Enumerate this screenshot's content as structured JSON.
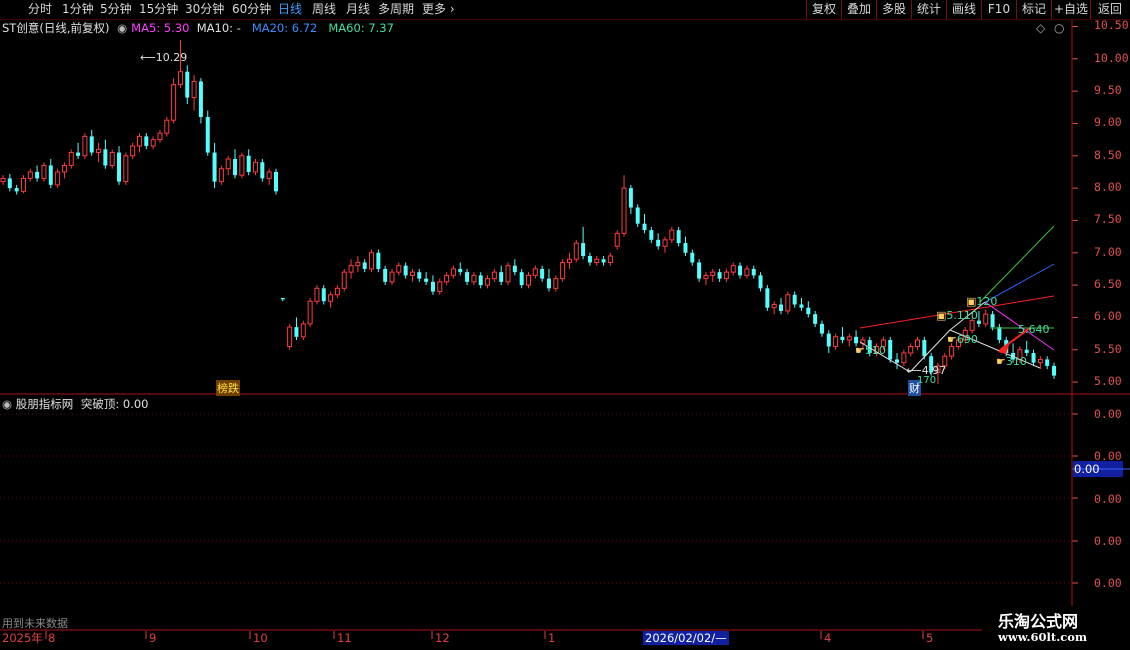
{
  "periods": [
    "分时",
    "1分钟",
    "5分钟",
    "15分钟",
    "30分钟",
    "60分钟",
    "日线",
    "周线",
    "月线",
    "多周期",
    "更多"
  ],
  "active_period": "日线",
  "right_tools": [
    "复权",
    "叠加",
    "多股",
    "统计",
    "画线",
    "F10",
    "标记",
    "+自选",
    "返回"
  ],
  "stock": {
    "name": "ST创意",
    "mode": "(日线,前复权)"
  },
  "ma": {
    "ma5": {
      "label": "MA5:",
      "value": "5.30",
      "color": "#ff40ff"
    },
    "ma10": {
      "label": "MA10:",
      "value": "-",
      "color": "#e0e0e0"
    },
    "ma20": {
      "label": "MA20:",
      "value": "6.72",
      "color": "#3a8cff"
    },
    "ma60": {
      "label": "MA60:",
      "value": "7.37",
      "color": "#40e0a0"
    }
  },
  "price_axis": [
    "10.50",
    "10.00",
    "9.50",
    "9.00",
    "8.50",
    "8.00",
    "7.50",
    "7.00",
    "6.50",
    "6.00",
    "5.50",
    "5.00"
  ],
  "indicator": {
    "name": "股朋指标网",
    "label": "突破顶:",
    "value": "0.00"
  },
  "indicator_axis": [
    "0.00",
    "0.00",
    "0.00",
    "0.00",
    "0.00"
  ],
  "indicator_current": "0.00",
  "future_note": "用到未来数据",
  "date_axis": {
    "year": "2025年",
    "months": [
      "8",
      "9",
      "10",
      "11",
      "12",
      "1",
      "4",
      "5"
    ],
    "cursor_date": "2026/02/02/—"
  },
  "annotations": {
    "high": "10.29",
    "low": "4.97",
    "badge_bangdie": "榜跌",
    "badge_cai": "财",
    "n1": "510",
    "n2": "690",
    "n3": "310",
    "n4": "5.640",
    "n5": "5.110",
    "n6": "120",
    "n7": "170"
  },
  "watermark": {
    "title": "乐淘公式网",
    "url": "www.60lt.com"
  },
  "colors": {
    "up": "#ff3b3b",
    "down": "#54ffff",
    "grid": "#7a0000",
    "axis": "#e05050"
  },
  "chart_data": {
    "type": "candlestick",
    "ylim": [
      4.8,
      10.6
    ],
    "candles": [
      [
        8.1,
        8.2,
        8.05,
        8.15
      ],
      [
        8.15,
        8.22,
        7.95,
        8.0
      ],
      [
        8.0,
        8.05,
        7.9,
        7.95
      ],
      [
        7.95,
        8.2,
        7.92,
        8.15
      ],
      [
        8.15,
        8.3,
        8.1,
        8.25
      ],
      [
        8.25,
        8.35,
        8.1,
        8.15
      ],
      [
        8.15,
        8.4,
        8.1,
        8.35
      ],
      [
        8.35,
        8.45,
        8.0,
        8.05
      ],
      [
        8.05,
        8.3,
        8.0,
        8.25
      ],
      [
        8.25,
        8.4,
        8.15,
        8.35
      ],
      [
        8.35,
        8.6,
        8.3,
        8.55
      ],
      [
        8.55,
        8.7,
        8.45,
        8.5
      ],
      [
        8.5,
        8.85,
        8.45,
        8.8
      ],
      [
        8.8,
        8.9,
        8.5,
        8.55
      ],
      [
        8.55,
        8.7,
        8.4,
        8.6
      ],
      [
        8.6,
        8.75,
        8.3,
        8.35
      ],
      [
        8.35,
        8.6,
        8.3,
        8.55
      ],
      [
        8.55,
        8.65,
        8.05,
        8.1
      ],
      [
        8.1,
        8.55,
        8.05,
        8.5
      ],
      [
        8.5,
        8.7,
        8.45,
        8.65
      ],
      [
        8.65,
        8.85,
        8.55,
        8.8
      ],
      [
        8.8,
        8.85,
        8.6,
        8.65
      ],
      [
        8.65,
        8.8,
        8.6,
        8.75
      ],
      [
        8.75,
        8.9,
        8.7,
        8.85
      ],
      [
        8.85,
        9.1,
        8.8,
        9.05
      ],
      [
        9.05,
        9.7,
        9.0,
        9.6
      ],
      [
        9.6,
        10.29,
        9.55,
        9.8
      ],
      [
        9.8,
        9.9,
        9.3,
        9.4
      ],
      [
        9.4,
        9.75,
        9.2,
        9.65
      ],
      [
        9.65,
        9.7,
        9.0,
        9.1
      ],
      [
        9.1,
        9.2,
        8.5,
        8.55
      ],
      [
        8.55,
        8.7,
        8.0,
        8.1
      ],
      [
        8.1,
        8.35,
        8.05,
        8.3
      ],
      [
        8.3,
        8.5,
        8.2,
        8.45
      ],
      [
        8.45,
        8.6,
        8.15,
        8.2
      ],
      [
        8.2,
        8.55,
        8.15,
        8.5
      ],
      [
        8.5,
        8.6,
        8.2,
        8.25
      ],
      [
        8.25,
        8.45,
        8.2,
        8.4
      ],
      [
        8.4,
        8.45,
        8.1,
        8.15
      ],
      [
        8.15,
        8.3,
        8.05,
        8.25
      ],
      [
        8.25,
        8.3,
        7.9,
        7.95
      ],
      [
        6.3,
        6.3,
        6.25,
        6.28
      ],
      [
        5.55,
        5.9,
        5.5,
        5.85
      ],
      [
        5.85,
        6.0,
        5.65,
        5.7
      ],
      [
        5.7,
        5.95,
        5.65,
        5.9
      ],
      [
        5.9,
        6.3,
        5.85,
        6.25
      ],
      [
        6.25,
        6.5,
        6.2,
        6.45
      ],
      [
        6.45,
        6.5,
        6.2,
        6.25
      ],
      [
        6.25,
        6.4,
        6.15,
        6.35
      ],
      [
        6.35,
        6.5,
        6.3,
        6.45
      ],
      [
        6.45,
        6.75,
        6.4,
        6.7
      ],
      [
        6.7,
        6.9,
        6.6,
        6.8
      ],
      [
        6.8,
        6.95,
        6.7,
        6.85
      ],
      [
        6.85,
        6.9,
        6.7,
        6.75
      ],
      [
        6.75,
        7.05,
        6.7,
        7.0
      ],
      [
        7.0,
        7.05,
        6.7,
        6.75
      ],
      [
        6.75,
        6.8,
        6.5,
        6.55
      ],
      [
        6.55,
        6.75,
        6.5,
        6.7
      ],
      [
        6.7,
        6.85,
        6.65,
        6.8
      ],
      [
        6.8,
        6.85,
        6.6,
        6.65
      ],
      [
        6.65,
        6.75,
        6.55,
        6.7
      ],
      [
        6.7,
        6.75,
        6.55,
        6.6
      ],
      [
        6.6,
        6.7,
        6.5,
        6.55
      ],
      [
        6.55,
        6.65,
        6.35,
        6.4
      ],
      [
        6.4,
        6.6,
        6.35,
        6.55
      ],
      [
        6.55,
        6.7,
        6.5,
        6.65
      ],
      [
        6.65,
        6.8,
        6.6,
        6.75
      ],
      [
        6.75,
        6.85,
        6.65,
        6.7
      ],
      [
        6.7,
        6.75,
        6.5,
        6.55
      ],
      [
        6.55,
        6.7,
        6.5,
        6.65
      ],
      [
        6.65,
        6.7,
        6.45,
        6.5
      ],
      [
        6.5,
        6.65,
        6.45,
        6.6
      ],
      [
        6.6,
        6.75,
        6.55,
        6.7
      ],
      [
        6.7,
        6.8,
        6.5,
        6.55
      ],
      [
        6.55,
        6.85,
        6.5,
        6.8
      ],
      [
        6.8,
        6.9,
        6.65,
        6.7
      ],
      [
        6.7,
        6.75,
        6.45,
        6.5
      ],
      [
        6.5,
        6.7,
        6.45,
        6.65
      ],
      [
        6.65,
        6.8,
        6.6,
        6.75
      ],
      [
        6.75,
        6.8,
        6.55,
        6.6
      ],
      [
        6.6,
        6.75,
        6.4,
        6.45
      ],
      [
        6.45,
        6.65,
        6.4,
        6.6
      ],
      [
        6.6,
        6.9,
        6.55,
        6.85
      ],
      [
        6.85,
        7.0,
        6.75,
        6.9
      ],
      [
        6.9,
        7.2,
        6.85,
        7.15
      ],
      [
        7.15,
        7.4,
        6.9,
        6.95
      ],
      [
        6.95,
        7.0,
        6.8,
        6.85
      ],
      [
        6.85,
        6.95,
        6.8,
        6.9
      ],
      [
        6.9,
        6.95,
        6.8,
        6.85
      ],
      [
        6.85,
        7.0,
        6.8,
        6.95
      ],
      [
        7.1,
        7.35,
        7.05,
        7.3
      ],
      [
        7.3,
        8.2,
        7.25,
        8.0
      ],
      [
        8.0,
        8.05,
        7.6,
        7.7
      ],
      [
        7.7,
        7.75,
        7.4,
        7.45
      ],
      [
        7.45,
        7.6,
        7.3,
        7.35
      ],
      [
        7.35,
        7.4,
        7.15,
        7.2
      ],
      [
        7.2,
        7.3,
        7.05,
        7.1
      ],
      [
        7.1,
        7.25,
        7.0,
        7.2
      ],
      [
        7.2,
        7.4,
        7.15,
        7.35
      ],
      [
        7.35,
        7.4,
        7.1,
        7.15
      ],
      [
        7.15,
        7.25,
        6.95,
        7.0
      ],
      [
        7.0,
        7.05,
        6.8,
        6.85
      ],
      [
        6.85,
        6.9,
        6.55,
        6.6
      ],
      [
        6.6,
        6.7,
        6.5,
        6.65
      ],
      [
        6.65,
        6.75,
        6.55,
        6.7
      ],
      [
        6.7,
        6.75,
        6.55,
        6.6
      ],
      [
        6.6,
        6.75,
        6.55,
        6.7
      ],
      [
        6.7,
        6.85,
        6.65,
        6.8
      ],
      [
        6.8,
        6.85,
        6.6,
        6.65
      ],
      [
        6.65,
        6.8,
        6.6,
        6.75
      ],
      [
        6.75,
        6.8,
        6.6,
        6.65
      ],
      [
        6.65,
        6.7,
        6.4,
        6.45
      ],
      [
        6.45,
        6.5,
        6.1,
        6.15
      ],
      [
        6.15,
        6.25,
        6.05,
        6.2
      ],
      [
        6.2,
        6.3,
        6.05,
        6.1
      ],
      [
        6.1,
        6.4,
        6.05,
        6.35
      ],
      [
        6.35,
        6.4,
        6.15,
        6.2
      ],
      [
        6.2,
        6.3,
        6.1,
        6.15
      ],
      [
        6.15,
        6.25,
        6.0,
        6.05
      ],
      [
        6.05,
        6.1,
        5.85,
        5.9
      ],
      [
        5.9,
        5.95,
        5.7,
        5.75
      ],
      [
        5.75,
        5.8,
        5.45,
        5.55
      ],
      [
        5.55,
        5.75,
        5.5,
        5.7
      ],
      [
        5.7,
        5.85,
        5.6,
        5.65
      ],
      [
        5.65,
        5.75,
        5.55,
        5.7
      ],
      [
        5.7,
        5.8,
        5.55,
        5.6
      ],
      [
        5.6,
        5.7,
        5.5,
        5.65
      ],
      [
        5.65,
        5.7,
        5.4,
        5.45
      ],
      [
        5.45,
        5.6,
        5.4,
        5.55
      ],
      [
        5.55,
        5.7,
        5.5,
        5.65
      ],
      [
        5.65,
        5.7,
        5.3,
        5.35
      ],
      [
        5.35,
        5.45,
        5.2,
        5.3
      ],
      [
        5.3,
        5.5,
        5.25,
        5.45
      ],
      [
        5.45,
        5.6,
        5.4,
        5.55
      ],
      [
        5.55,
        5.7,
        5.5,
        5.65
      ],
      [
        5.65,
        5.7,
        5.35,
        5.4
      ],
      [
        5.4,
        5.45,
        5.1,
        5.15
      ],
      [
        5.15,
        5.3,
        4.97,
        5.25
      ],
      [
        5.25,
        5.45,
        5.2,
        5.4
      ],
      [
        5.4,
        5.6,
        5.35,
        5.55
      ],
      [
        5.55,
        5.7,
        5.5,
        5.65
      ],
      [
        5.65,
        5.85,
        5.6,
        5.8
      ],
      [
        5.8,
        6.0,
        5.75,
        5.95
      ],
      [
        5.95,
        6.1,
        5.85,
        5.9
      ],
      [
        5.9,
        6.12,
        5.85,
        6.05
      ],
      [
        6.05,
        6.1,
        5.8,
        5.85
      ],
      [
        5.85,
        5.9,
        5.6,
        5.65
      ],
      [
        5.65,
        5.7,
        5.4,
        5.45
      ],
      [
        5.45,
        5.6,
        5.3,
        5.35
      ],
      [
        5.35,
        5.55,
        5.3,
        5.5
      ],
      [
        5.5,
        5.64,
        5.4,
        5.45
      ],
      [
        5.45,
        5.5,
        5.25,
        5.3
      ],
      [
        5.3,
        5.4,
        5.2,
        5.35
      ],
      [
        5.35,
        5.4,
        5.2,
        5.25
      ],
      [
        5.25,
        5.3,
        5.05,
        5.1
      ]
    ]
  }
}
